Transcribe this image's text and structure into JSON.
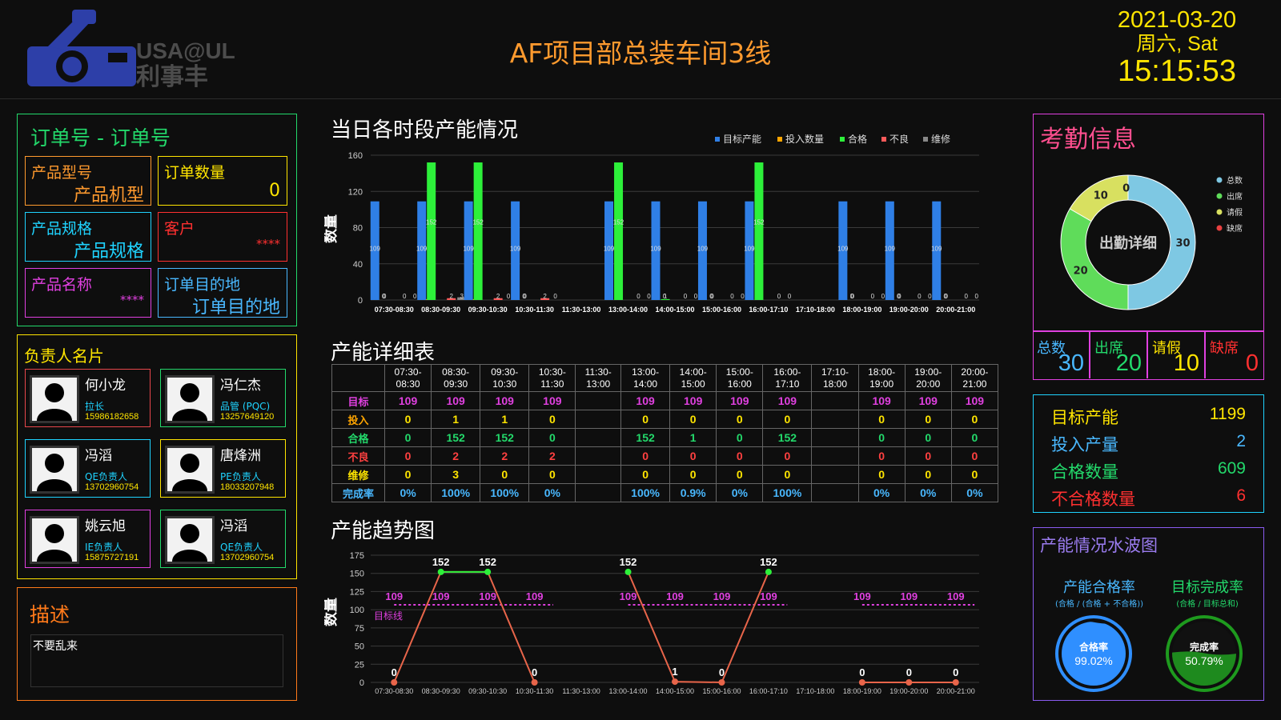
{
  "header": {
    "logo_text": "USA@UL",
    "logo_subtext": "利事丰",
    "title": "AF项目部总装车间3线",
    "date": "2021-03-20",
    "weekday": "周六, Sat",
    "time": "15:15:53"
  },
  "order": {
    "heading": "订单号 - 订单号",
    "model_label": "产品型号",
    "model_value": "产品机型",
    "qty_label": "订单数量",
    "qty_value": "0",
    "spec_label": "产品规格",
    "spec_value": "产品规格",
    "customer_label": "客户",
    "customer_value": "****",
    "name_label": "产品名称",
    "name_value": "****",
    "dest_label": "订单目的地",
    "dest_value": "订单目的地"
  },
  "persons": {
    "heading": "负责人名片",
    "list": [
      {
        "name": "何小龙",
        "role": "拉长",
        "phone": "15986182658",
        "color": "#e8474c"
      },
      {
        "name": "冯仁杰",
        "role": "品管 (PQC)",
        "phone": "13257649120",
        "color": "#23d96b"
      },
      {
        "name": "冯滔",
        "role": "QE负责人",
        "phone": "13702960754",
        "color": "#1fd3ff"
      },
      {
        "name": "唐烽洲",
        "role": "PE负责人",
        "phone": "18033207948",
        "color": "#ffe500"
      },
      {
        "name": "姚云旭",
        "role": "IE负责人",
        "phone": "15875727191",
        "color": "#e040e0"
      },
      {
        "name": "冯滔",
        "role": "QE负责人",
        "phone": "13702960754",
        "color": "#23d96b"
      }
    ]
  },
  "desc": {
    "heading": "描述",
    "text": "不要乱来"
  },
  "sections": {
    "hourly_title": "当日各时段产能情况",
    "table_title": "产能详细表",
    "trend_title": "产能趋势图"
  },
  "slots": [
    "07:30-08:30",
    "08:30-09:30",
    "09:30-10:30",
    "10:30-11:30",
    "11:30-13:00",
    "13:00-14:00",
    "14:00-15:00",
    "15:00-16:00",
    "16:00-17:10",
    "17:10-18:00",
    "18:00-19:00",
    "19:00-20:00",
    "20:00-21:00"
  ],
  "table": {
    "headers": [
      [
        "07:30-",
        "08:30"
      ],
      [
        "08:30-",
        "09:30"
      ],
      [
        "09:30-",
        "10:30"
      ],
      [
        "10:30-",
        "11:30"
      ],
      [
        "11:30-",
        "13:00"
      ],
      [
        "13:00-",
        "14:00"
      ],
      [
        "14:00-",
        "15:00"
      ],
      [
        "15:00-",
        "16:00"
      ],
      [
        "16:00-",
        "17:10"
      ],
      [
        "17:10-",
        "18:00"
      ],
      [
        "18:00-",
        "19:00"
      ],
      [
        "19:00-",
        "20:00"
      ],
      [
        "20:00-",
        "21:00"
      ]
    ],
    "rows": [
      {
        "label": "目标",
        "label_color": "#e040e0",
        "color": "#e040e0",
        "cells": [
          "109",
          "109",
          "109",
          "109",
          "",
          "109",
          "109",
          "109",
          "109",
          "",
          "109",
          "109",
          "109"
        ]
      },
      {
        "label": "投入",
        "label_color": "#ffa500",
        "color": "#ffe500",
        "cells": [
          "0",
          "1",
          "1",
          "0",
          "",
          "0",
          "0",
          "0",
          "0",
          "",
          "0",
          "0",
          "0"
        ]
      },
      {
        "label": "合格",
        "label_color": "#23d96b",
        "color": "#23d96b",
        "cells": [
          "0",
          "152",
          "152",
          "0",
          "",
          "152",
          "1",
          "0",
          "152",
          "",
          "0",
          "0",
          "0"
        ]
      },
      {
        "label": "不良",
        "label_color": "#ff4040",
        "color": "#ff4040",
        "cells": [
          "0",
          "2",
          "2",
          "2",
          "",
          "0",
          "0",
          "0",
          "0",
          "",
          "0",
          "0",
          "0"
        ]
      },
      {
        "label": "维修",
        "label_color": "#ffe500",
        "color": "#ffe500",
        "cells": [
          "0",
          "3",
          "0",
          "0",
          "",
          "0",
          "0",
          "0",
          "0",
          "",
          "0",
          "0",
          "0"
        ]
      },
      {
        "label": "完成率",
        "label_color": "#49b8ff",
        "color": "#49b8ff",
        "cells": [
          "0%",
          "100%",
          "100%",
          "0%",
          "",
          "100%",
          "0.9%",
          "0%",
          "100%",
          "",
          "0%",
          "0%",
          "0%"
        ]
      }
    ]
  },
  "chart_data": [
    {
      "type": "bar",
      "title": "当日各时段产能情况",
      "ylabel": "数量",
      "ylim": [
        0,
        160
      ],
      "yticks": [
        "0",
        "40",
        "80",
        "120",
        "160"
      ],
      "categories": [
        "07:30-08:30",
        "08:30-09:30",
        "09:30-10:30",
        "10:30-11:30",
        "11:30-13:00",
        "13:00-14:00",
        "14:00-15:00",
        "15:00-16:00",
        "16:00-17:10",
        "17:10-18:00",
        "18:00-19:00",
        "19:00-20:00",
        "20:00-21:00"
      ],
      "legend_position": "top-right",
      "series": [
        {
          "name": "目标产能",
          "color": "#2f7fe6",
          "values": [
            109,
            109,
            109,
            109,
            null,
            109,
            109,
            109,
            109,
            null,
            109,
            109,
            109
          ]
        },
        {
          "name": "投入数量",
          "color": "#ffa500",
          "values": [
            0,
            1,
            1,
            0,
            null,
            0,
            0,
            0,
            0,
            null,
            0,
            0,
            0
          ]
        },
        {
          "name": "合格",
          "color": "#2df03a",
          "values": [
            0,
            152,
            152,
            0,
            null,
            152,
            1,
            0,
            152,
            null,
            0,
            0,
            0
          ]
        },
        {
          "name": "不良",
          "color": "#ff5a5a",
          "values": [
            0,
            2,
            2,
            2,
            null,
            0,
            0,
            0,
            0,
            null,
            0,
            0,
            0
          ]
        },
        {
          "name": "维修",
          "color": "#888888",
          "values": [
            0,
            3,
            0,
            0,
            null,
            0,
            0,
            0,
            0,
            null,
            0,
            0,
            0
          ]
        }
      ]
    },
    {
      "type": "line",
      "title": "产能趋势图",
      "ylabel": "数量",
      "ylim": [
        0,
        175
      ],
      "yticks": [
        "0",
        "25",
        "50",
        "75",
        "100",
        "125",
        "150",
        "175"
      ],
      "categories": [
        "07:30-08:30",
        "08:30-09:30",
        "09:30-10:30",
        "10:30-11:30",
        "11:30-13:00",
        "13:00-14:00",
        "14:00-15:00",
        "15:00-16:00",
        "16:00-17:10",
        "17:10-18:00",
        "18:00-19:00",
        "19:00-20:00",
        "20:00-21:00"
      ],
      "target_label": "目标线",
      "series": [
        {
          "name": "合格",
          "values": [
            0,
            152,
            152,
            0,
            null,
            152,
            1,
            0,
            152,
            null,
            0,
            0,
            0
          ]
        },
        {
          "name": "目标",
          "values": [
            109,
            109,
            109,
            109,
            null,
            109,
            109,
            109,
            109,
            null,
            109,
            109,
            109
          ]
        }
      ]
    },
    {
      "type": "pie",
      "title": "出勤详细",
      "legend_position": "top-right",
      "slices": [
        {
          "label": "总数",
          "value": 30,
          "color": "#7ec8e3"
        },
        {
          "label": "出席",
          "value": 20,
          "color": "#5fdc5a"
        },
        {
          "label": "请假",
          "value": 10,
          "color": "#d8e060"
        },
        {
          "label": "缺席",
          "value": 0,
          "color": "#e84040"
        }
      ]
    }
  ],
  "attendance": {
    "heading": "考勤信息",
    "donut_label": "出勤详细",
    "cells": [
      {
        "label": "总数",
        "value": "30",
        "color": "#49b8ff"
      },
      {
        "label": "出席",
        "value": "20",
        "color": "#23d96b"
      },
      {
        "label": "请假",
        "value": "10",
        "color": "#ffe500"
      },
      {
        "label": "缺席",
        "value": "0",
        "color": "#ff3030"
      }
    ]
  },
  "summary": {
    "target_label": "目标产能",
    "target_value": "1199",
    "input_label": "投入产量",
    "input_value": "2",
    "pass_label": "合格数量",
    "pass_value": "609",
    "fail_label": "不合格数量",
    "fail_value": "6"
  },
  "gauges": {
    "heading": "产能情况水波图",
    "pass_title": "产能合格率",
    "pass_sub": "(合格 / (合格 + 不合格))",
    "pass_inner": "合格率",
    "pass_value": "99.02%",
    "pass_fraction": 0.9902,
    "done_title": "目标完成率",
    "done_sub": "(合格 / 目标总和)",
    "done_inner": "完成率",
    "done_value": "50.79%",
    "done_fraction": 0.5079
  }
}
